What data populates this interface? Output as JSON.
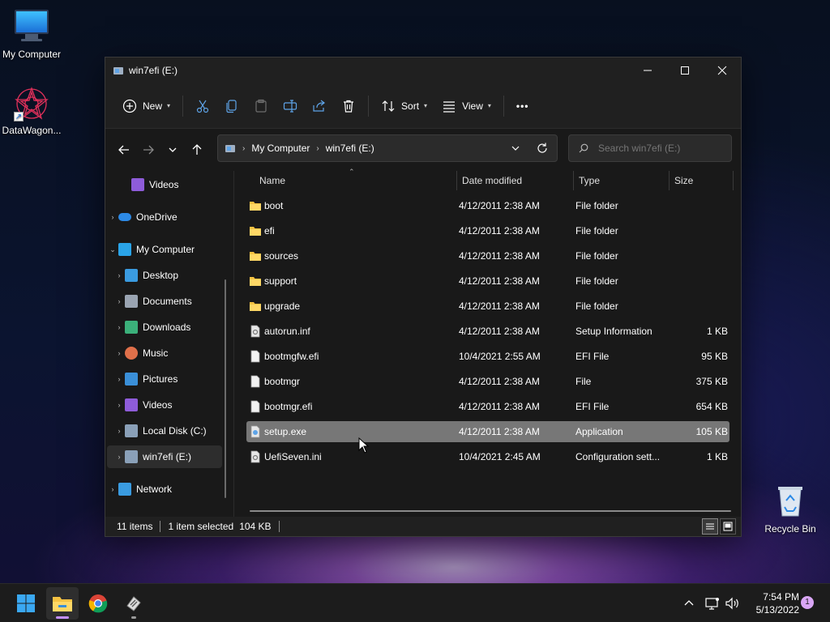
{
  "desktop": {
    "icons": [
      {
        "label": "My Computer"
      },
      {
        "label": "DataWagon..."
      },
      {
        "label": "Recycle Bin"
      }
    ]
  },
  "window": {
    "title": "win7efi (E:)",
    "controls": {
      "minimize": "—",
      "maximize": "☐",
      "close": "✕"
    }
  },
  "toolbar": {
    "new_label": "New",
    "sort_label": "Sort",
    "view_label": "View",
    "more_label": "•••"
  },
  "address": {
    "crumbs": [
      "My Computer",
      "win7efi (E:)"
    ],
    "search_placeholder": "Search win7efi (E:)"
  },
  "sidebar": {
    "items": [
      {
        "label": "Videos",
        "icon": "videos-icon",
        "color": "#8e5cd9"
      },
      {
        "label": "OneDrive",
        "icon": "onedrive-icon",
        "color": "#2d8ae6"
      },
      {
        "label": "My Computer",
        "icon": "computer-icon",
        "color": "#2aa4e8"
      },
      {
        "label": "Desktop",
        "icon": "desktop-icon",
        "color": "#3a9be0"
      },
      {
        "label": "Documents",
        "icon": "documents-icon",
        "color": "#9aa4b2"
      },
      {
        "label": "Downloads",
        "icon": "downloads-icon",
        "color": "#3bb07a"
      },
      {
        "label": "Music",
        "icon": "music-icon",
        "color": "#e0704a"
      },
      {
        "label": "Pictures",
        "icon": "pictures-icon",
        "color": "#3a8fd8"
      },
      {
        "label": "Videos",
        "icon": "videos-icon",
        "color": "#8e5cd9"
      },
      {
        "label": "Local Disk (C:)",
        "icon": "drive-icon",
        "color": "#8aa0b8"
      },
      {
        "label": "win7efi (E:)",
        "icon": "drive-icon",
        "color": "#8aa0b8"
      },
      {
        "label": "Network",
        "icon": "network-icon",
        "color": "#3a9be0"
      }
    ]
  },
  "list": {
    "columns": {
      "name": "Name",
      "date": "Date modified",
      "type": "Type",
      "size": "Size"
    },
    "rows": [
      {
        "name": "boot",
        "date": "4/12/2011 2:38 AM",
        "type": "File folder",
        "size": "",
        "icon": "folder-icon"
      },
      {
        "name": "efi",
        "date": "4/12/2011 2:38 AM",
        "type": "File folder",
        "size": "",
        "icon": "folder-icon"
      },
      {
        "name": "sources",
        "date": "4/12/2011 2:38 AM",
        "type": "File folder",
        "size": "",
        "icon": "folder-icon"
      },
      {
        "name": "support",
        "date": "4/12/2011 2:38 AM",
        "type": "File folder",
        "size": "",
        "icon": "folder-icon"
      },
      {
        "name": "upgrade",
        "date": "4/12/2011 2:38 AM",
        "type": "File folder",
        "size": "",
        "icon": "folder-icon"
      },
      {
        "name": "autorun.inf",
        "date": "4/12/2011 2:38 AM",
        "type": "Setup Information",
        "size": "1 KB",
        "icon": "settings-file-icon"
      },
      {
        "name": "bootmgfw.efi",
        "date": "10/4/2021 2:55 AM",
        "type": "EFI File",
        "size": "95 KB",
        "icon": "file-icon"
      },
      {
        "name": "bootmgr",
        "date": "4/12/2011 2:38 AM",
        "type": "File",
        "size": "375 KB",
        "icon": "file-icon"
      },
      {
        "name": "bootmgr.efi",
        "date": "4/12/2011 2:38 AM",
        "type": "EFI File",
        "size": "654 KB",
        "icon": "file-icon"
      },
      {
        "name": "setup.exe",
        "date": "4/12/2011 2:38 AM",
        "type": "Application",
        "size": "105 KB",
        "icon": "exe-icon"
      },
      {
        "name": "UefiSeven.ini",
        "date": "10/4/2021 2:45 AM",
        "type": "Configuration sett...",
        "size": "1 KB",
        "icon": "settings-file-icon"
      }
    ]
  },
  "status": {
    "items": "11 items",
    "selected": "1 item selected",
    "size": "104 KB"
  },
  "taskbar": {
    "time": "7:54 PM",
    "date": "5/13/2022",
    "notification_count": "1"
  },
  "colors": {
    "folder": "#f5c242",
    "accent": "#c490ff",
    "selection": "#777777"
  }
}
